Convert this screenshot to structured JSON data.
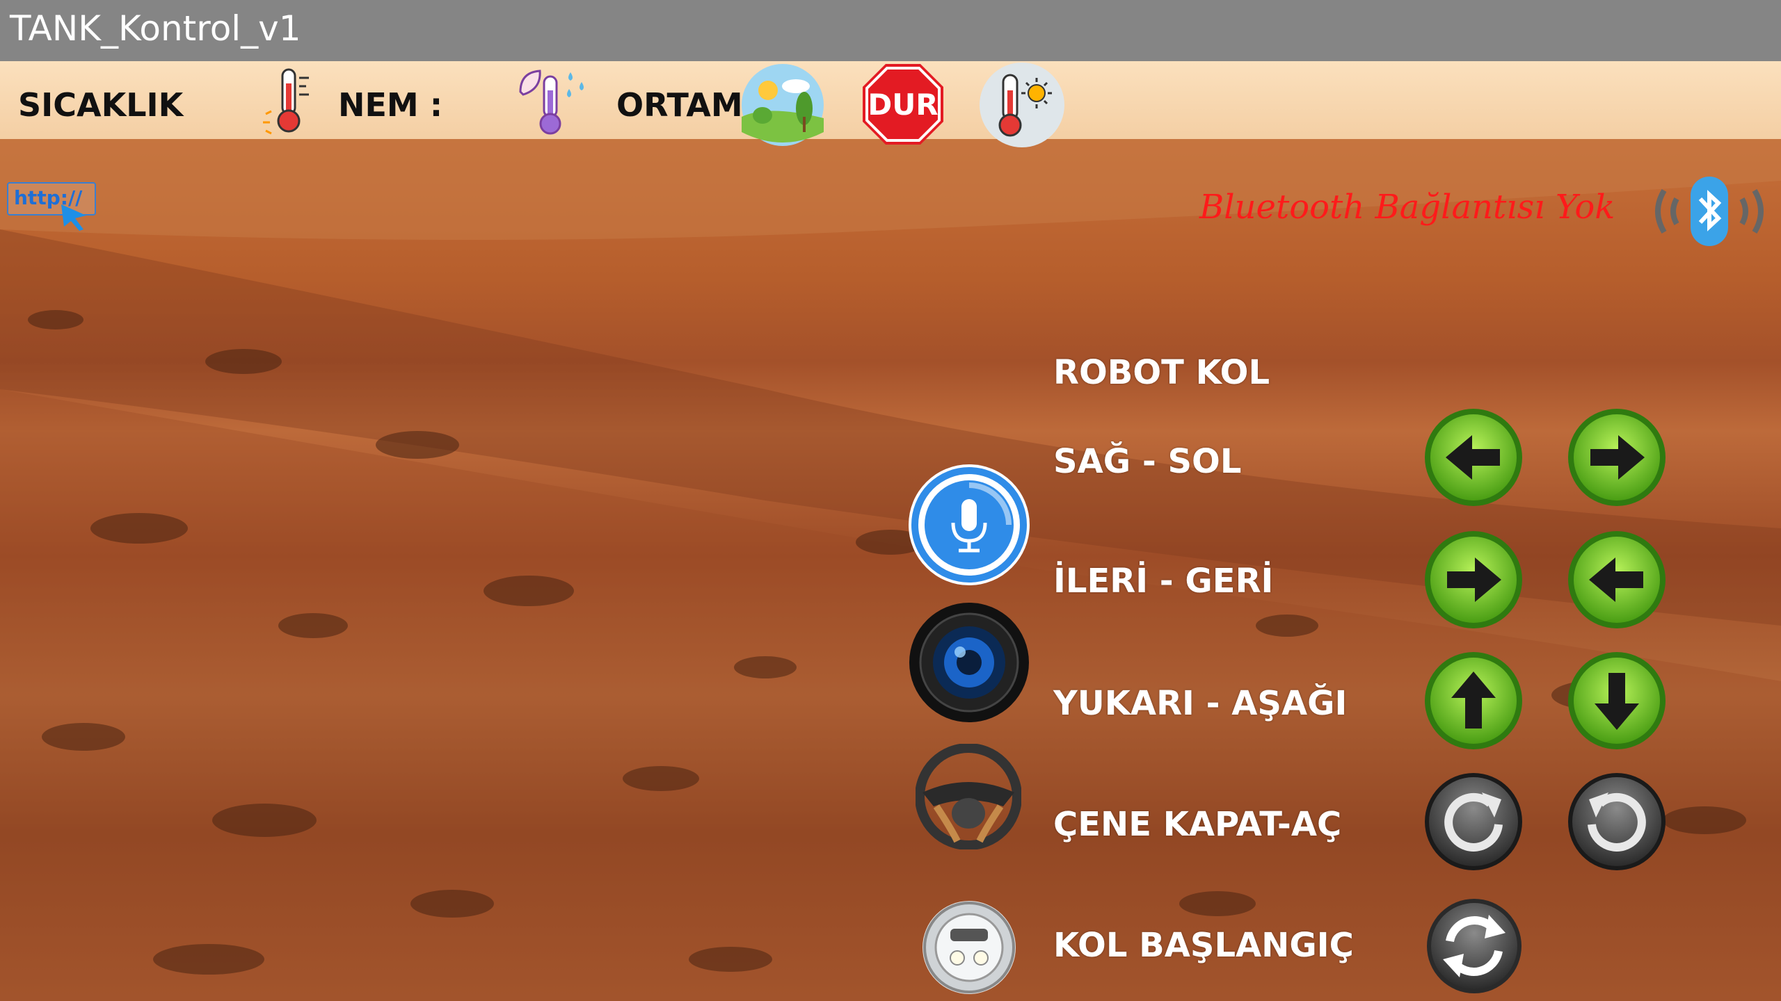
{
  "app": {
    "title": "TANK_Kontrol_v1"
  },
  "sensors": {
    "temperature_label": "SICAKLIK",
    "humidity_label": "NEM :",
    "environment_label": "ORTAM :",
    "stop_label": "DUR"
  },
  "connection": {
    "link_label": "http://",
    "status_text": "Bluetooth Bağlantısı Yok",
    "status_color": "#ff1a1a"
  },
  "arm": {
    "title": "ROBOT KOL",
    "rows": [
      {
        "label": "SAĞ - SOL",
        "left_icon": "arrow-left-icon",
        "right_icon": "arrow-right-icon"
      },
      {
        "label": "İLERİ - GERİ",
        "left_icon": "arrow-right-icon",
        "right_icon": "arrow-left-icon"
      },
      {
        "label": "YUKARI - AŞAĞI",
        "left_icon": "arrow-up-icon",
        "right_icon": "arrow-down-icon"
      },
      {
        "label": "ÇENE KAPAT-AÇ",
        "left_icon": "rotate-clockwise-icon",
        "right_icon": "rotate-counterclockwise-icon"
      },
      {
        "label": "KOL BAŞLANGIÇ",
        "left_icon": "refresh-icon"
      }
    ]
  },
  "side_buttons": [
    "microphone-icon",
    "camera-icon",
    "steering-wheel-icon",
    "headlight-icon"
  ],
  "colors": {
    "green": "#6fd12b",
    "titlebar": "#858585"
  }
}
